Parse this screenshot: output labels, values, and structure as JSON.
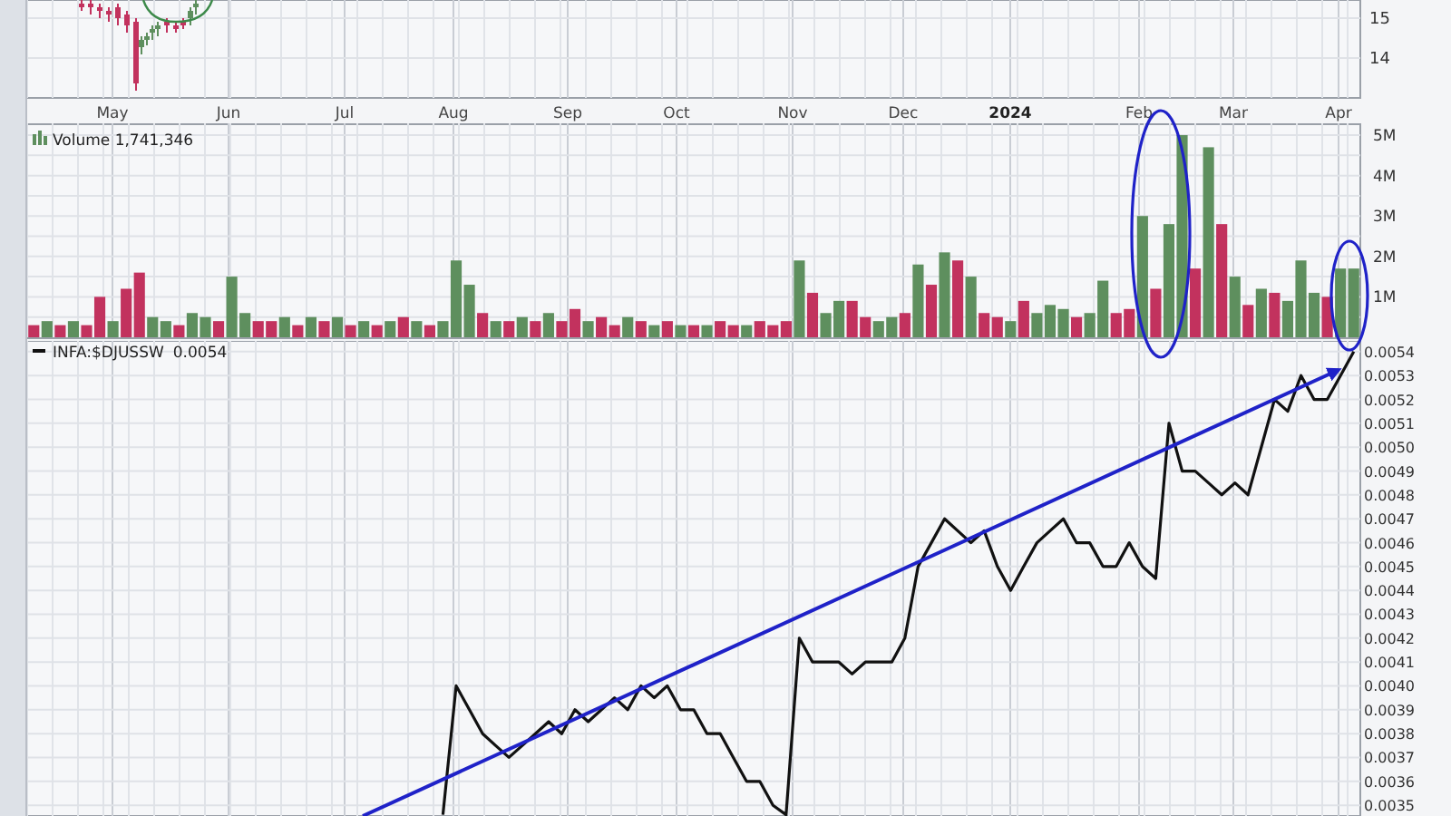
{
  "price_panel": {
    "axis_labels": [
      "15",
      "14"
    ]
  },
  "date_axis": [
    {
      "label": "May",
      "kind": "month"
    },
    {
      "label": "Jun",
      "kind": "month"
    },
    {
      "label": "Jul",
      "kind": "month"
    },
    {
      "label": "Aug",
      "kind": "month"
    },
    {
      "label": "Sep",
      "kind": "month"
    },
    {
      "label": "Oct",
      "kind": "month"
    },
    {
      "label": "Nov",
      "kind": "month"
    },
    {
      "label": "Dec",
      "kind": "month"
    },
    {
      "label": "2024",
      "kind": "year"
    },
    {
      "label": "Feb",
      "kind": "month"
    },
    {
      "label": "Mar",
      "kind": "month"
    },
    {
      "label": "Apr",
      "kind": "month"
    }
  ],
  "volume_panel": {
    "legend": "Volume 1,741,346",
    "chart_data": {
      "type": "bar",
      "stacked": true,
      "grid": true,
      "ylim": [
        0,
        5.27
      ],
      "yticks": [
        {
          "value": 1,
          "label": "1M"
        },
        {
          "value": 2,
          "label": "2M"
        },
        {
          "value": 3,
          "label": "3M"
        },
        {
          "value": 4,
          "label": "4M"
        },
        {
          "value": 5,
          "label": "5M"
        }
      ],
      "series": [
        {
          "color": "#5e8f5e",
          "values": [
            null,
            0.4,
            null,
            0.4,
            null,
            null,
            0.4,
            null,
            null,
            0.5,
            0.4,
            null,
            0.6,
            0.5,
            null,
            1.5,
            0.6,
            null,
            null,
            0.5,
            null,
            0.5,
            null,
            0.5,
            null,
            0.4,
            null,
            0.4,
            null,
            0.4,
            null,
            0.4,
            1.9,
            1.3,
            null,
            0.4,
            null,
            0.5,
            null,
            0.6,
            null,
            null,
            0.4,
            null,
            null,
            0.5,
            null,
            0.3,
            null,
            0.3,
            null,
            0.3,
            null,
            null,
            0.3,
            null,
            null,
            null,
            1.9,
            null,
            0.6,
            0.9,
            null,
            null,
            0.4,
            0.5,
            null,
            1.8,
            null,
            2.1,
            null,
            1.5,
            null,
            null,
            0.4,
            null,
            0.6,
            0.8,
            0.7,
            null,
            0.6,
            1.4,
            null,
            null,
            3.0,
            null,
            2.8,
            5.0,
            null,
            4.7,
            null,
            1.5,
            null,
            1.2,
            null,
            0.9,
            1.9,
            1.1,
            null,
            1.7,
            1.7
          ]
        },
        {
          "color": "#c2325e",
          "values": [
            0.3,
            null,
            0.3,
            null,
            0.3,
            1.0,
            null,
            1.2,
            1.6,
            null,
            null,
            0.3,
            null,
            null,
            0.4,
            null,
            null,
            0.4,
            0.4,
            null,
            0.3,
            null,
            0.4,
            null,
            0.3,
            null,
            0.3,
            null,
            0.5,
            null,
            0.3,
            null,
            null,
            null,
            0.6,
            null,
            0.4,
            null,
            0.4,
            null,
            0.4,
            0.7,
            null,
            0.5,
            0.3,
            null,
            0.4,
            null,
            0.4,
            null,
            0.3,
            null,
            0.4,
            0.3,
            null,
            0.4,
            0.3,
            0.4,
            null,
            1.1,
            null,
            null,
            0.9,
            0.5,
            null,
            null,
            0.6,
            null,
            1.3,
            null,
            1.9,
            null,
            0.6,
            0.5,
            null,
            0.9,
            null,
            null,
            null,
            0.5,
            null,
            null,
            0.6,
            0.7,
            null,
            1.2,
            null,
            null,
            1.7,
            null,
            2.8,
            null,
            0.8,
            null,
            1.1,
            null,
            null,
            null,
            1.0,
            null,
            null
          ]
        }
      ]
    }
  },
  "ratio_panel": {
    "legend_value": "0.0054",
    "chart_data": {
      "type": "line",
      "grid": true,
      "ylim": [
        0.003455,
        0.005445
      ],
      "yticks": [
        {
          "value": 0.0054,
          "label": "0.0054"
        },
        {
          "value": 0.0053,
          "label": "0.0053"
        },
        {
          "value": 0.0052,
          "label": "0.0052"
        },
        {
          "value": 0.0051,
          "label": "0.0051"
        },
        {
          "value": 0.005,
          "label": "0.0050"
        },
        {
          "value": 0.0049,
          "label": "0.0049"
        },
        {
          "value": 0.0048,
          "label": "0.0048"
        },
        {
          "value": 0.0047,
          "label": "0.0047"
        },
        {
          "value": 0.0046,
          "label": "0.0046"
        },
        {
          "value": 0.0045,
          "label": "0.0045"
        },
        {
          "value": 0.0044,
          "label": "0.0044"
        },
        {
          "value": 0.0043,
          "label": "0.0043"
        },
        {
          "value": 0.0042,
          "label": "0.0042"
        },
        {
          "value": 0.0041,
          "label": "0.0041"
        },
        {
          "value": 0.004,
          "label": "0.0040"
        },
        {
          "value": 0.0039,
          "label": "0.0039"
        },
        {
          "value": 0.0038,
          "label": "0.0038"
        },
        {
          "value": 0.0037,
          "label": "0.0037"
        },
        {
          "value": 0.0036,
          "label": "0.0036"
        },
        {
          "value": 0.0035,
          "label": "0.0035"
        }
      ],
      "series": [
        {
          "name": "INFA:$DJUSSW",
          "color": "#111111",
          "values": [
            null,
            null,
            null,
            null,
            null,
            null,
            null,
            null,
            null,
            null,
            null,
            null,
            null,
            null,
            null,
            null,
            null,
            null,
            null,
            null,
            null,
            null,
            null,
            null,
            null,
            null,
            null,
            null,
            null,
            null,
            null,
            0.00346,
            0.004,
            0.0039,
            0.0038,
            0.00375,
            0.0037,
            0.00375,
            0.0038,
            0.00385,
            0.0038,
            0.0039,
            0.00385,
            0.0039,
            0.00395,
            0.0039,
            0.004,
            0.00395,
            0.004,
            0.0039,
            0.0039,
            0.0038,
            0.0038,
            0.0037,
            0.0036,
            0.0036,
            0.0035,
            0.00346,
            0.0042,
            0.0041,
            0.0041,
            0.0041,
            0.00405,
            0.0041,
            0.0041,
            0.0041,
            0.0042,
            0.0045,
            0.0046,
            0.0047,
            0.00465,
            0.0046,
            0.00465,
            0.0045,
            0.0044,
            0.0045,
            0.0046,
            0.00465,
            0.0047,
            0.0046,
            0.0046,
            0.0045,
            0.0045,
            0.0046,
            0.0045,
            0.00445,
            0.0051,
            0.0049,
            0.0049,
            0.00485,
            0.0048,
            0.00485,
            0.0048,
            0.005,
            0.0052,
            0.00515,
            0.0053,
            0.0052,
            0.0052,
            0.0053,
            0.0054
          ]
        }
      ]
    }
  }
}
